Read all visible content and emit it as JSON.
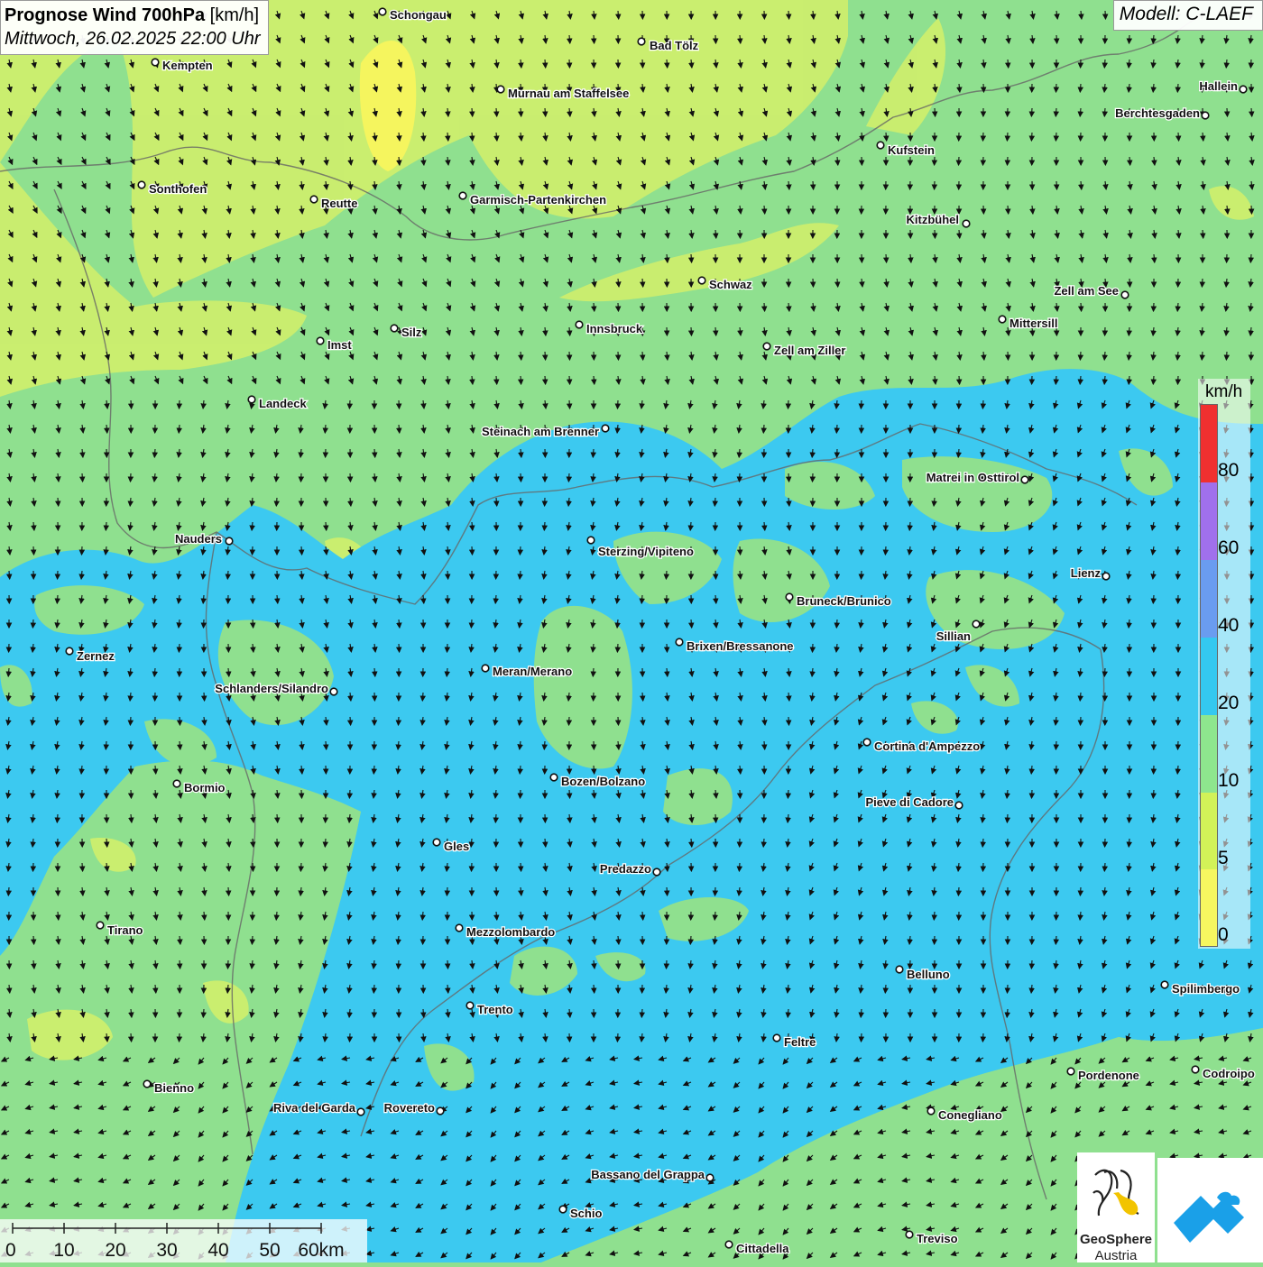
{
  "header": {
    "title_bold": "Prognose Wind 700hPa",
    "title_unit": "[km/h]",
    "datetime": "Mittwoch, 26.02.2025 22:00 Uhr",
    "model": "Modell: C-LAEF"
  },
  "legend": {
    "unit": "km/h",
    "labels": [
      "80",
      "60",
      "40",
      "20",
      "10",
      "5",
      "0"
    ],
    "colors": [
      "#f03030",
      "#a070ec",
      "#6a9cf0",
      "#34c8f0",
      "#8ee68e",
      "#d2f258",
      "#f6f660"
    ]
  },
  "scalebar": {
    "labels": [
      "0",
      "10",
      "20",
      "30",
      "40",
      "50",
      "60km"
    ]
  },
  "places": [
    {
      "name": "Schongau"
    },
    {
      "name": "Bad Tölz"
    },
    {
      "name": "Kempten"
    },
    {
      "name": "Murnau am Staffelsee"
    },
    {
      "name": "Hallein"
    },
    {
      "name": "Berchtesgaden"
    },
    {
      "name": "Kufstein"
    },
    {
      "name": "Sonthofen"
    },
    {
      "name": "Reutte"
    },
    {
      "name": "Garmisch-Partenkirchen"
    },
    {
      "name": "Kitzbühel"
    },
    {
      "name": "Schwaz"
    },
    {
      "name": "Zell am See"
    },
    {
      "name": "Mittersill"
    },
    {
      "name": "Innsbruck"
    },
    {
      "name": "Silz"
    },
    {
      "name": "Imst"
    },
    {
      "name": "Zell am Ziller"
    },
    {
      "name": "Landeck"
    },
    {
      "name": "Steinach am Brenner"
    },
    {
      "name": "Matrei in Osttirol"
    },
    {
      "name": "Nauders"
    },
    {
      "name": "Sterzing/Vipiteno"
    },
    {
      "name": "Lienz"
    },
    {
      "name": "Bruneck/Brunico"
    },
    {
      "name": "Sillian"
    },
    {
      "name": "Brixen/Bressanone"
    },
    {
      "name": "Zernez"
    },
    {
      "name": "Meran/Merano"
    },
    {
      "name": "Schlanders/Silandro"
    },
    {
      "name": "Cortina d'Ampezzo"
    },
    {
      "name": "Bozen/Bolzano"
    },
    {
      "name": "Bormio"
    },
    {
      "name": "Pieve di Cadore"
    },
    {
      "name": "Gles"
    },
    {
      "name": "Predazzo"
    },
    {
      "name": "Tirano"
    },
    {
      "name": "Mezzolombardo"
    },
    {
      "name": "Belluno"
    },
    {
      "name": "Spilimbergo"
    },
    {
      "name": "Trento"
    },
    {
      "name": "Feltre"
    },
    {
      "name": "Pordenone"
    },
    {
      "name": "Codroipo"
    },
    {
      "name": "Bienno"
    },
    {
      "name": "Riva del Garda"
    },
    {
      "name": "Rovereto"
    },
    {
      "name": "Conegliano"
    },
    {
      "name": "Bassano del Grappa"
    },
    {
      "name": "Schio"
    },
    {
      "name": "Treviso"
    },
    {
      "name": "Cittadella"
    }
  ],
  "logos": {
    "geosphere_line1": "GeoSphere",
    "geosphere_line2": "Austria"
  }
}
